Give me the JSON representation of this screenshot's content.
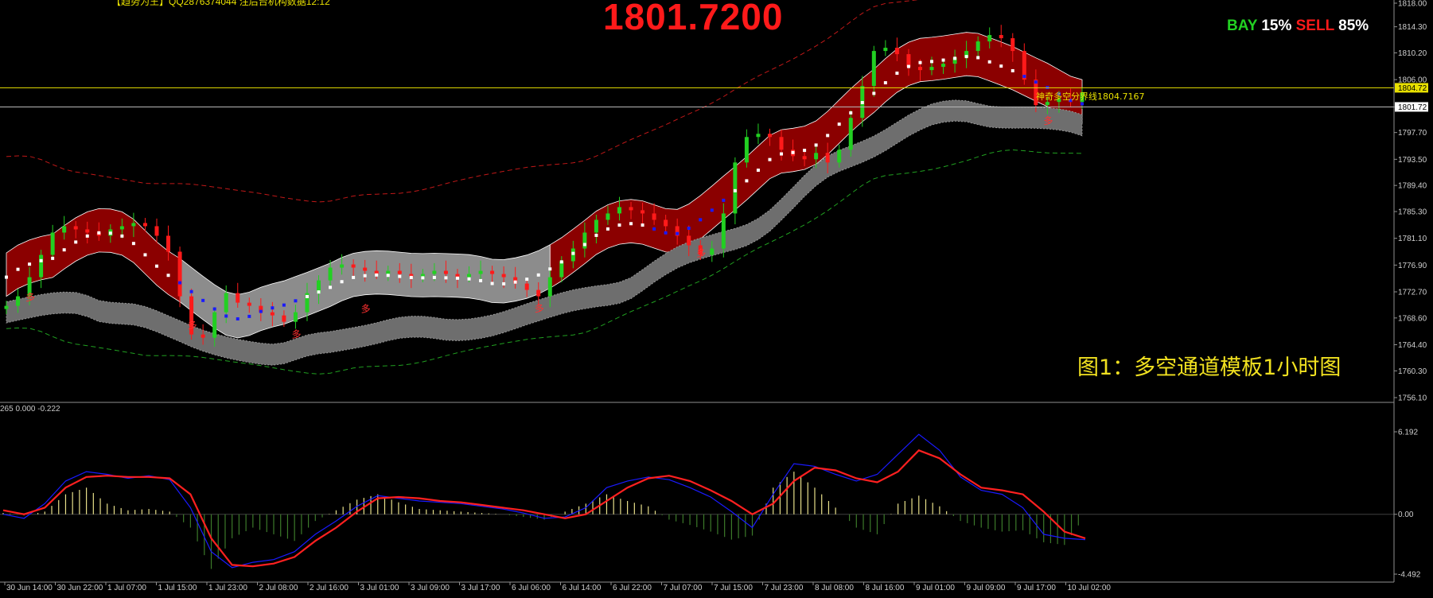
{
  "header": {
    "top_text": "【趋势为王】QQ2876374044 注后台机构数据12:12",
    "big_price": "1801.7200",
    "bay_label": "BAY",
    "bay_pct": "15%",
    "sell_label": "SELL",
    "sell_pct": "85%"
  },
  "caption": "图1：多空通道模板1小时图",
  "line_label": "神奇多空分界线1804.7167",
  "macd_info": "265 0.000 -0.222",
  "colors": {
    "background": "#000000",
    "bull_candle": "#22d022",
    "bear_candle": "#ff1a1a",
    "bull_channel": "#8b0000",
    "neutral_channel": "#8c8c8c",
    "lower_channel": "#6e6e6e",
    "level_line": "#e8e000",
    "macd_signal": "#ff2020",
    "macd_line": "#1a1aff",
    "macd_hist_pos": "#e8e08a",
    "macd_hist_neg": "#3c7a2a"
  },
  "chart_data": [
    {
      "type": "line",
      "title": "",
      "x_ticks": [
        "30 Jun 14:00",
        "30 Jun 22:00",
        "1 Jul 07:00",
        "1 Jul 15:00",
        "1 Jul 23:00",
        "2 Jul 08:00",
        "2 Jul 16:00",
        "3 Jul 01:00",
        "3 Jul 09:00",
        "3 Jul 17:00",
        "6 Jul 06:00",
        "6 Jul 14:00",
        "6 Jul 22:00",
        "7 Jul 07:00",
        "7 Jul 15:00",
        "7 Jul 23:00",
        "8 Jul 08:00",
        "8 Jul 16:00",
        "9 Jul 01:00",
        "9 Jul 09:00",
        "9 Jul 17:00",
        "10 Jul 02:00"
      ],
      "y_ticks": [
        "1818.00",
        "1814.30",
        "1810.20",
        "1806.00",
        "1801.72",
        "1797.70",
        "1793.50",
        "1789.40",
        "1785.30",
        "1781.10",
        "1776.90",
        "1772.70",
        "1768.60",
        "1764.40",
        "1760.30",
        "1756.10"
      ],
      "ylim": [
        1756.1,
        1818.0
      ],
      "current_price": 1801.72,
      "current_price_label": "1801.72",
      "level_line": 1804.72,
      "level_line_label": "1804.72",
      "close_series": [
        1770.5,
        1772.0,
        1775.0,
        1778.5,
        1782.0,
        1783.0,
        1782.5,
        1782.0,
        1781.5,
        1782.5,
        1783.0,
        1783.5,
        1783.0,
        1781.5,
        1779.0,
        1772.0,
        1766.0,
        1765.5,
        1769.5,
        1772.5,
        1771.0,
        1770.5,
        1769.5,
        1769.0,
        1768.0,
        1769.5,
        1772.5,
        1774.5,
        1776.5,
        1777.0,
        1776.5,
        1776.0,
        1775.5,
        1776.0,
        1775.5,
        1775.0,
        1775.5,
        1776.0,
        1775.5,
        1775.0,
        1775.5,
        1776.0,
        1775.5,
        1775.0,
        1774.0,
        1773.0,
        1772.0,
        1775.0,
        1777.5,
        1779.5,
        1782.0,
        1784.0,
        1785.0,
        1786.0,
        1785.5,
        1785.0,
        1784.0,
        1783.0,
        1781.5,
        1780.0,
        1778.5,
        1779.5,
        1785.0,
        1793.0,
        1797.0,
        1797.5,
        1797.0,
        1795.0,
        1794.0,
        1793.5,
        1794.5,
        1793.0,
        1795.0,
        1800.0,
        1805.0,
        1810.5,
        1811.0,
        1810.0,
        1808.0,
        1807.5,
        1808.0,
        1808.5,
        1809.5,
        1810.5,
        1812.0,
        1813.0,
        1812.5,
        1810.5,
        1806.0,
        1802.0,
        1802.5,
        1803.0,
        1802.5,
        1804.0
      ],
      "annotations": [
        "多",
        "多",
        "多",
        "多",
        "多",
        "多",
        "多"
      ]
    },
    {
      "type": "line",
      "title": "",
      "ylim": [
        -4.492,
        6.192
      ],
      "y_ticks": [
        "6.192",
        "0.00",
        "-4.492"
      ],
      "series": [
        {
          "values": [
            0.3,
            0.0,
            0.5,
            2.0,
            2.8,
            2.9,
            2.8,
            2.8,
            2.7,
            1.5,
            -1.8,
            -3.8,
            -3.9,
            -3.7,
            -3.2,
            -2.0,
            -1.0,
            0.2,
            1.2,
            1.3,
            1.2,
            1.0,
            0.9,
            0.7,
            0.5,
            0.3,
            0.0,
            -0.3,
            0.0,
            1.0,
            2.0,
            2.7,
            2.9,
            2.5,
            1.8,
            1.0,
            0.0,
            0.8,
            2.5,
            3.5,
            3.3,
            2.7,
            2.4,
            3.2,
            4.8,
            4.2,
            3.0,
            2.0,
            1.8,
            1.5,
            0.2,
            -1.3,
            -1.8
          ]
        },
        {
          "values": [
            0.0,
            -0.3,
            0.8,
            2.5,
            3.2,
            3.0,
            2.7,
            2.9,
            2.6,
            0.5,
            -2.8,
            -4.0,
            -3.6,
            -3.4,
            -2.8,
            -1.5,
            -0.5,
            0.6,
            1.4,
            1.2,
            1.0,
            0.9,
            0.8,
            0.6,
            0.4,
            0.1,
            -0.3,
            -0.2,
            0.5,
            2.0,
            2.5,
            2.8,
            2.6,
            2.0,
            1.3,
            0.2,
            -1.0,
            1.5,
            3.8,
            3.6,
            3.0,
            2.5,
            3.0,
            4.5,
            6.0,
            4.8,
            2.8,
            1.8,
            1.5,
            0.5,
            -1.5,
            -1.8,
            -1.9
          ]
        },
        {
          "values": [
            0.1,
            -0.1,
            0.2,
            1.5,
            2.0,
            0.8,
            0.3,
            0.4,
            0.2,
            -1.0,
            -4.1,
            -1.8,
            -1.0,
            -1.5,
            -2.0,
            -0.5,
            0.3,
            1.1,
            1.5,
            0.9,
            0.4,
            0.3,
            0.2,
            0.1,
            0.0,
            -0.2,
            -0.4,
            0.2,
            0.8,
            1.5,
            1.0,
            0.6,
            -0.4,
            -0.8,
            -1.3,
            -1.9,
            -1.6,
            2.0,
            3.2,
            2.0,
            0.5,
            -1.0,
            -1.5,
            0.8,
            1.4,
            0.6,
            -0.5,
            -1.0,
            -1.3,
            -1.2,
            -2.1,
            -2.3,
            -0.1
          ]
        }
      ]
    }
  ]
}
